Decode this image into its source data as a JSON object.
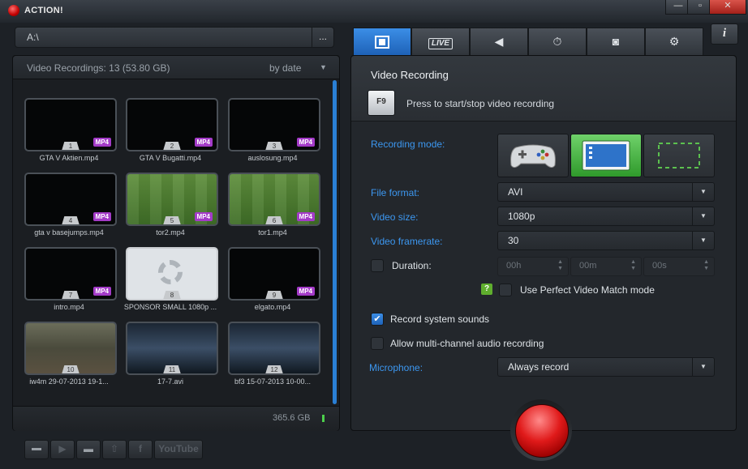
{
  "app": {
    "title": "ACTION!"
  },
  "window": {
    "minimize": "—",
    "maximize": "▫",
    "close": "✕"
  },
  "path": {
    "value": "A:\\",
    "browse": "..."
  },
  "recordings": {
    "header": "Video Recordings: 13 (53.80 GB)",
    "sort": "by date",
    "disk_free": "365.6 GB",
    "items": [
      {
        "num": "1",
        "badge": "MP4",
        "name": "GTA V Aktien.mp4"
      },
      {
        "num": "2",
        "badge": "MP4",
        "name": "GTA V Bugatti.mp4"
      },
      {
        "num": "3",
        "badge": "MP4",
        "name": "auslosung.mp4"
      },
      {
        "num": "4",
        "badge": "MP4",
        "name": "gta v basejumps.mp4"
      },
      {
        "num": "5",
        "badge": "MP4",
        "name": "tor2.mp4"
      },
      {
        "num": "6",
        "badge": "MP4",
        "name": "tor1.mp4"
      },
      {
        "num": "7",
        "badge": "MP4",
        "name": "intro.mp4"
      },
      {
        "num": "8",
        "badge": "",
        "name": "SPONSOR SMALL 1080p ..."
      },
      {
        "num": "9",
        "badge": "MP4",
        "name": "elgato.mp4"
      },
      {
        "num": "10",
        "badge": "",
        "name": "iw4m 29-07-2013 19-1..."
      },
      {
        "num": "11",
        "badge": "",
        "name": "17-7.avi"
      },
      {
        "num": "12",
        "badge": "",
        "name": "bf3 15-07-2013 10-00..."
      }
    ]
  },
  "toolbar": {
    "youtube": "YouTube",
    "facebook": "f"
  },
  "tabs": {
    "live": "LIVE",
    "info": "i"
  },
  "video": {
    "title": "Video Recording",
    "hotkey": "F9",
    "hotkey_desc": "Press to start/stop video recording",
    "recording_mode_label": "Recording mode:",
    "file_format_label": "File format:",
    "file_format": "AVI",
    "video_size_label": "Video size:",
    "video_size": "1080p",
    "framerate_label": "Video framerate:",
    "framerate": "30",
    "duration_label": "Duration:",
    "duration_h": "00h",
    "duration_m": "00m",
    "duration_s": "00s",
    "help": "?",
    "pvm_label": "Use Perfect Video Match mode",
    "sys_sounds_label": "Record system sounds",
    "multi_audio_label": "Allow multi-channel audio recording",
    "mic_label": "Microphone:",
    "mic_value": "Always record"
  },
  "colors": {
    "accent": "#1e62b8",
    "label_blue": "#3c97f0",
    "badge": "#a43bc8",
    "record": "#e01a1a"
  }
}
